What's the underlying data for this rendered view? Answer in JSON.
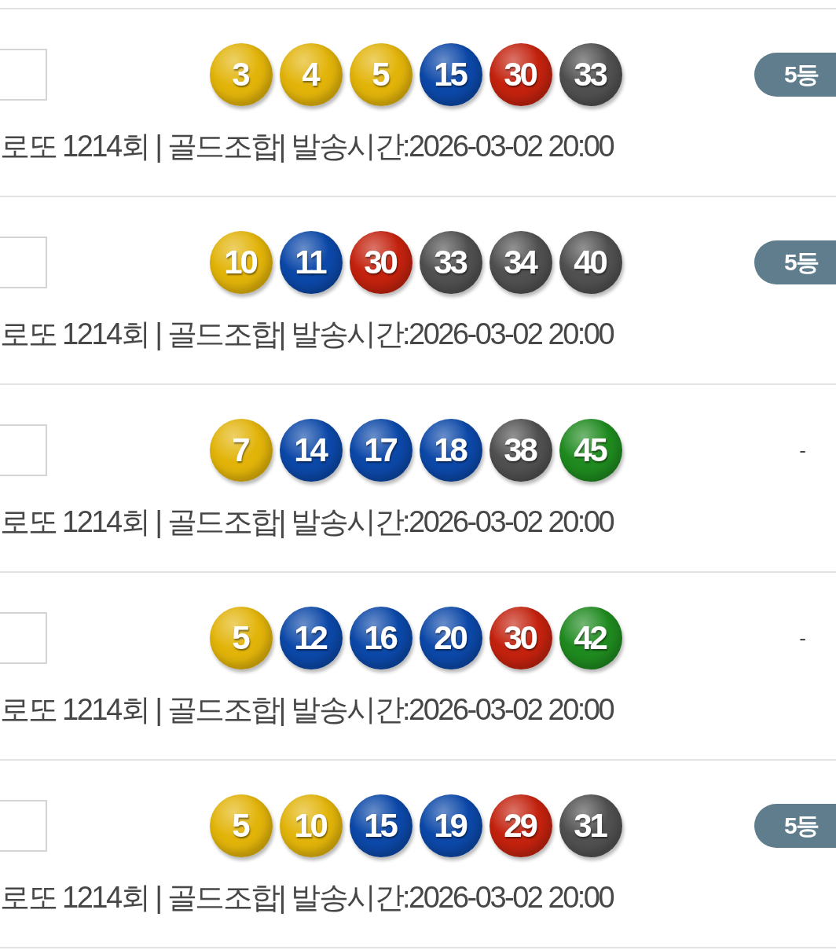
{
  "rows": [
    {
      "checked": false,
      "balls": [
        {
          "number": "3",
          "color": "#e2b40a"
        },
        {
          "number": "4",
          "color": "#e2b40a"
        },
        {
          "number": "5",
          "color": "#e2b40a"
        },
        {
          "number": "15",
          "color": "#0c48a8"
        },
        {
          "number": "30",
          "color": "#c3220e"
        },
        {
          "number": "33",
          "color": "#505050"
        }
      ],
      "result": {
        "kind": "badge",
        "text": "5등"
      },
      "meta": "로또 1214회 | 골드조합| 발송시간:2026-03-02 20:00"
    },
    {
      "checked": false,
      "balls": [
        {
          "number": "10",
          "color": "#e2b40a"
        },
        {
          "number": "11",
          "color": "#0c48a8"
        },
        {
          "number": "30",
          "color": "#c3220e"
        },
        {
          "number": "33",
          "color": "#505050"
        },
        {
          "number": "34",
          "color": "#505050"
        },
        {
          "number": "40",
          "color": "#505050"
        }
      ],
      "result": {
        "kind": "badge",
        "text": "5등"
      },
      "meta": "로또 1214회 | 골드조합| 발송시간:2026-03-02 20:00"
    },
    {
      "checked": false,
      "balls": [
        {
          "number": "7",
          "color": "#e2b40a"
        },
        {
          "number": "14",
          "color": "#0c48a8"
        },
        {
          "number": "17",
          "color": "#0c48a8"
        },
        {
          "number": "18",
          "color": "#0c48a8"
        },
        {
          "number": "38",
          "color": "#505050"
        },
        {
          "number": "45",
          "color": "#1f8a1f"
        }
      ],
      "result": {
        "kind": "dash",
        "text": "-"
      },
      "meta": "로또 1214회 | 골드조합| 발송시간:2026-03-02 20:00"
    },
    {
      "checked": false,
      "balls": [
        {
          "number": "5",
          "color": "#e2b40a"
        },
        {
          "number": "12",
          "color": "#0c48a8"
        },
        {
          "number": "16",
          "color": "#0c48a8"
        },
        {
          "number": "20",
          "color": "#0c48a8"
        },
        {
          "number": "30",
          "color": "#c3220e"
        },
        {
          "number": "42",
          "color": "#1f8a1f"
        }
      ],
      "result": {
        "kind": "dash",
        "text": "-"
      },
      "meta": "로또 1214회 | 골드조합| 발송시간:2026-03-02 20:00"
    },
    {
      "checked": false,
      "balls": [
        {
          "number": "5",
          "color": "#e2b40a"
        },
        {
          "number": "10",
          "color": "#e2b40a"
        },
        {
          "number": "15",
          "color": "#0c48a8"
        },
        {
          "number": "19",
          "color": "#0c48a8"
        },
        {
          "number": "29",
          "color": "#c3220e"
        },
        {
          "number": "31",
          "color": "#505050"
        }
      ],
      "result": {
        "kind": "badge",
        "text": "5등"
      },
      "meta": "로또 1214회 | 골드조합| 발송시간:2026-03-02 20:00"
    }
  ]
}
